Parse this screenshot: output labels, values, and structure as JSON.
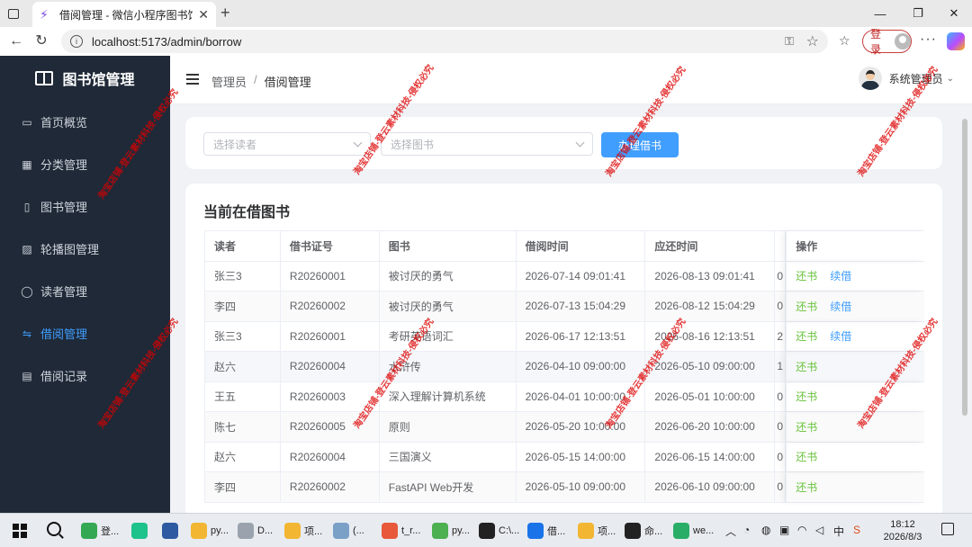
{
  "browser": {
    "tab_title": "借阅管理 - 微信小程序图书馆|图书",
    "url": "localhost:5173/admin/borrow",
    "login_label": "登录"
  },
  "sidebar": {
    "brand": "图书馆管理",
    "items": [
      {
        "label": "首页概览",
        "icon": "monitor-icon",
        "active": false
      },
      {
        "label": "分类管理",
        "icon": "grid-icon",
        "active": false
      },
      {
        "label": "图书管理",
        "icon": "book-icon",
        "active": false
      },
      {
        "label": "轮播图管理",
        "icon": "picture-icon",
        "active": false
      },
      {
        "label": "读者管理",
        "icon": "user-icon",
        "active": false
      },
      {
        "label": "借阅管理",
        "icon": "swap-icon",
        "active": true
      },
      {
        "label": "借阅记录",
        "icon": "document-icon",
        "active": false
      }
    ]
  },
  "header": {
    "breadcrumb": [
      "管理员",
      "借阅管理"
    ],
    "user_name": "系统管理员"
  },
  "form": {
    "reader_placeholder": "选择读者",
    "book_placeholder": "选择图书",
    "submit_label": "办理借书"
  },
  "table": {
    "title": "当前在借图书",
    "columns": [
      "读者",
      "借书证号",
      "图书",
      "借阅时间",
      "应还时间",
      "",
      "操作"
    ],
    "return_label": "还书",
    "renew_label": "续借",
    "rows": [
      {
        "reader": "张三3",
        "card": "R20260001",
        "book": "被讨厌的勇气",
        "borrow": "2026-07-14 09:01:41",
        "due": "2026-08-13 09:01:41",
        "extra": "0",
        "renew": true
      },
      {
        "reader": "李四",
        "card": "R20260002",
        "book": "被讨厌的勇气",
        "borrow": "2026-07-13 15:04:29",
        "due": "2026-08-12 15:04:29",
        "extra": "0",
        "renew": true
      },
      {
        "reader": "张三3",
        "card": "R20260001",
        "book": "考研英语词汇",
        "borrow": "2026-06-17 12:13:51",
        "due": "2026-08-16 12:13:51",
        "extra": "2",
        "renew": true
      },
      {
        "reader": "赵六",
        "card": "R20260004",
        "book": "水浒传",
        "borrow": "2026-04-10 09:00:00",
        "due": "2026-05-10 09:00:00",
        "extra": "1",
        "renew": false
      },
      {
        "reader": "王五",
        "card": "R20260003",
        "book": "深入理解计算机系统",
        "borrow": "2026-04-01 10:00:00",
        "due": "2026-05-01 10:00:00",
        "extra": "0",
        "renew": false
      },
      {
        "reader": "陈七",
        "card": "R20260005",
        "book": "原则",
        "borrow": "2026-05-20 10:00:00",
        "due": "2026-06-20 10:00:00",
        "extra": "0",
        "renew": false
      },
      {
        "reader": "赵六",
        "card": "R20260004",
        "book": "三国演义",
        "borrow": "2026-05-15 14:00:00",
        "due": "2026-06-15 14:00:00",
        "extra": "0",
        "renew": false
      },
      {
        "reader": "李四",
        "card": "R20260002",
        "book": "FastAPI Web开发",
        "borrow": "2026-05-10 09:00:00",
        "due": "2026-06-10 09:00:00",
        "extra": "0",
        "renew": false
      }
    ]
  },
  "watermark": "淘宝店铺-登云素材科技-侵权必究",
  "taskbar": {
    "apps": [
      "登...",
      "",
      "",
      "py...",
      "D...",
      "项...",
      "(...",
      "t_r...",
      "py...",
      "C:\\...",
      "借...",
      "项...",
      "命...",
      "we..."
    ],
    "time": "18:12",
    "date": "2026/8/3",
    "tray_lang": "中"
  },
  "colors": {
    "sidebar_bg": "#1f2937",
    "accent": "#409eff",
    "success": "#67c23a",
    "watermark": "#dc0000"
  }
}
